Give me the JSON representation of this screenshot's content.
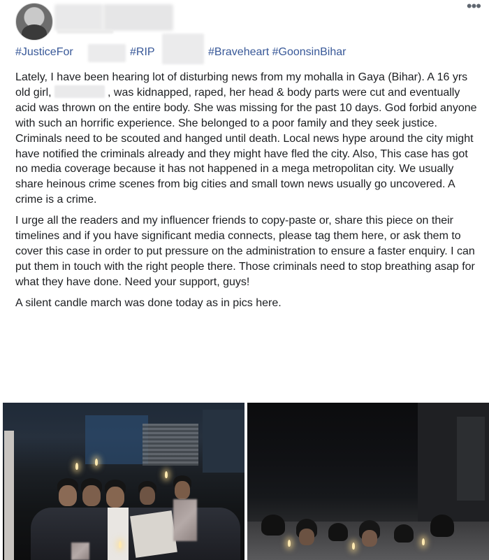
{
  "header": {
    "more_icon": "more-horizontal-icon",
    "more_glyph": "•••"
  },
  "hashtags": [
    "#JusticeFor",
    "#RIP",
    "#Braveheart #GoonsinBihar"
  ],
  "paragraphs": {
    "p1_before": "Lately, I have been hearing lot of disturbing news from my mohalla in Gaya (Bihar). A 16 yrs old girl,",
    "p1_after": ", was kidnapped, raped, her head & body parts were cut and eventually acid was thrown on the entire body. She was missing for the past 10 days. God forbid anyone with such an horrific experience. She belonged to a poor family and they seek justice. Criminals need to be scouted and hanged until death. Local news hype around the city might have notified the criminals already and they might have fled the city. Also, This case has got no media coverage because it has not happened in a mega metropolitan city. We usually share heinous crime scenes from big cities and small town news usually go uncovered. A crime is a crime.",
    "p2": "I urge all the readers and my influencer friends to copy-paste or, share this piece on their timelines and if you have significant media connects, please tag them here, or ask them to cover this case in order to put pressure on the administration to ensure a faster enquiry. I can put them in touch with the right people there. Those criminals need to stop breathing asap for what they have done. Need your support, guys!",
    "p3": "A silent candle march was done today as in pics here."
  },
  "colors": {
    "text": "#1c1e21",
    "link": "#385898",
    "icon": "#606770"
  }
}
